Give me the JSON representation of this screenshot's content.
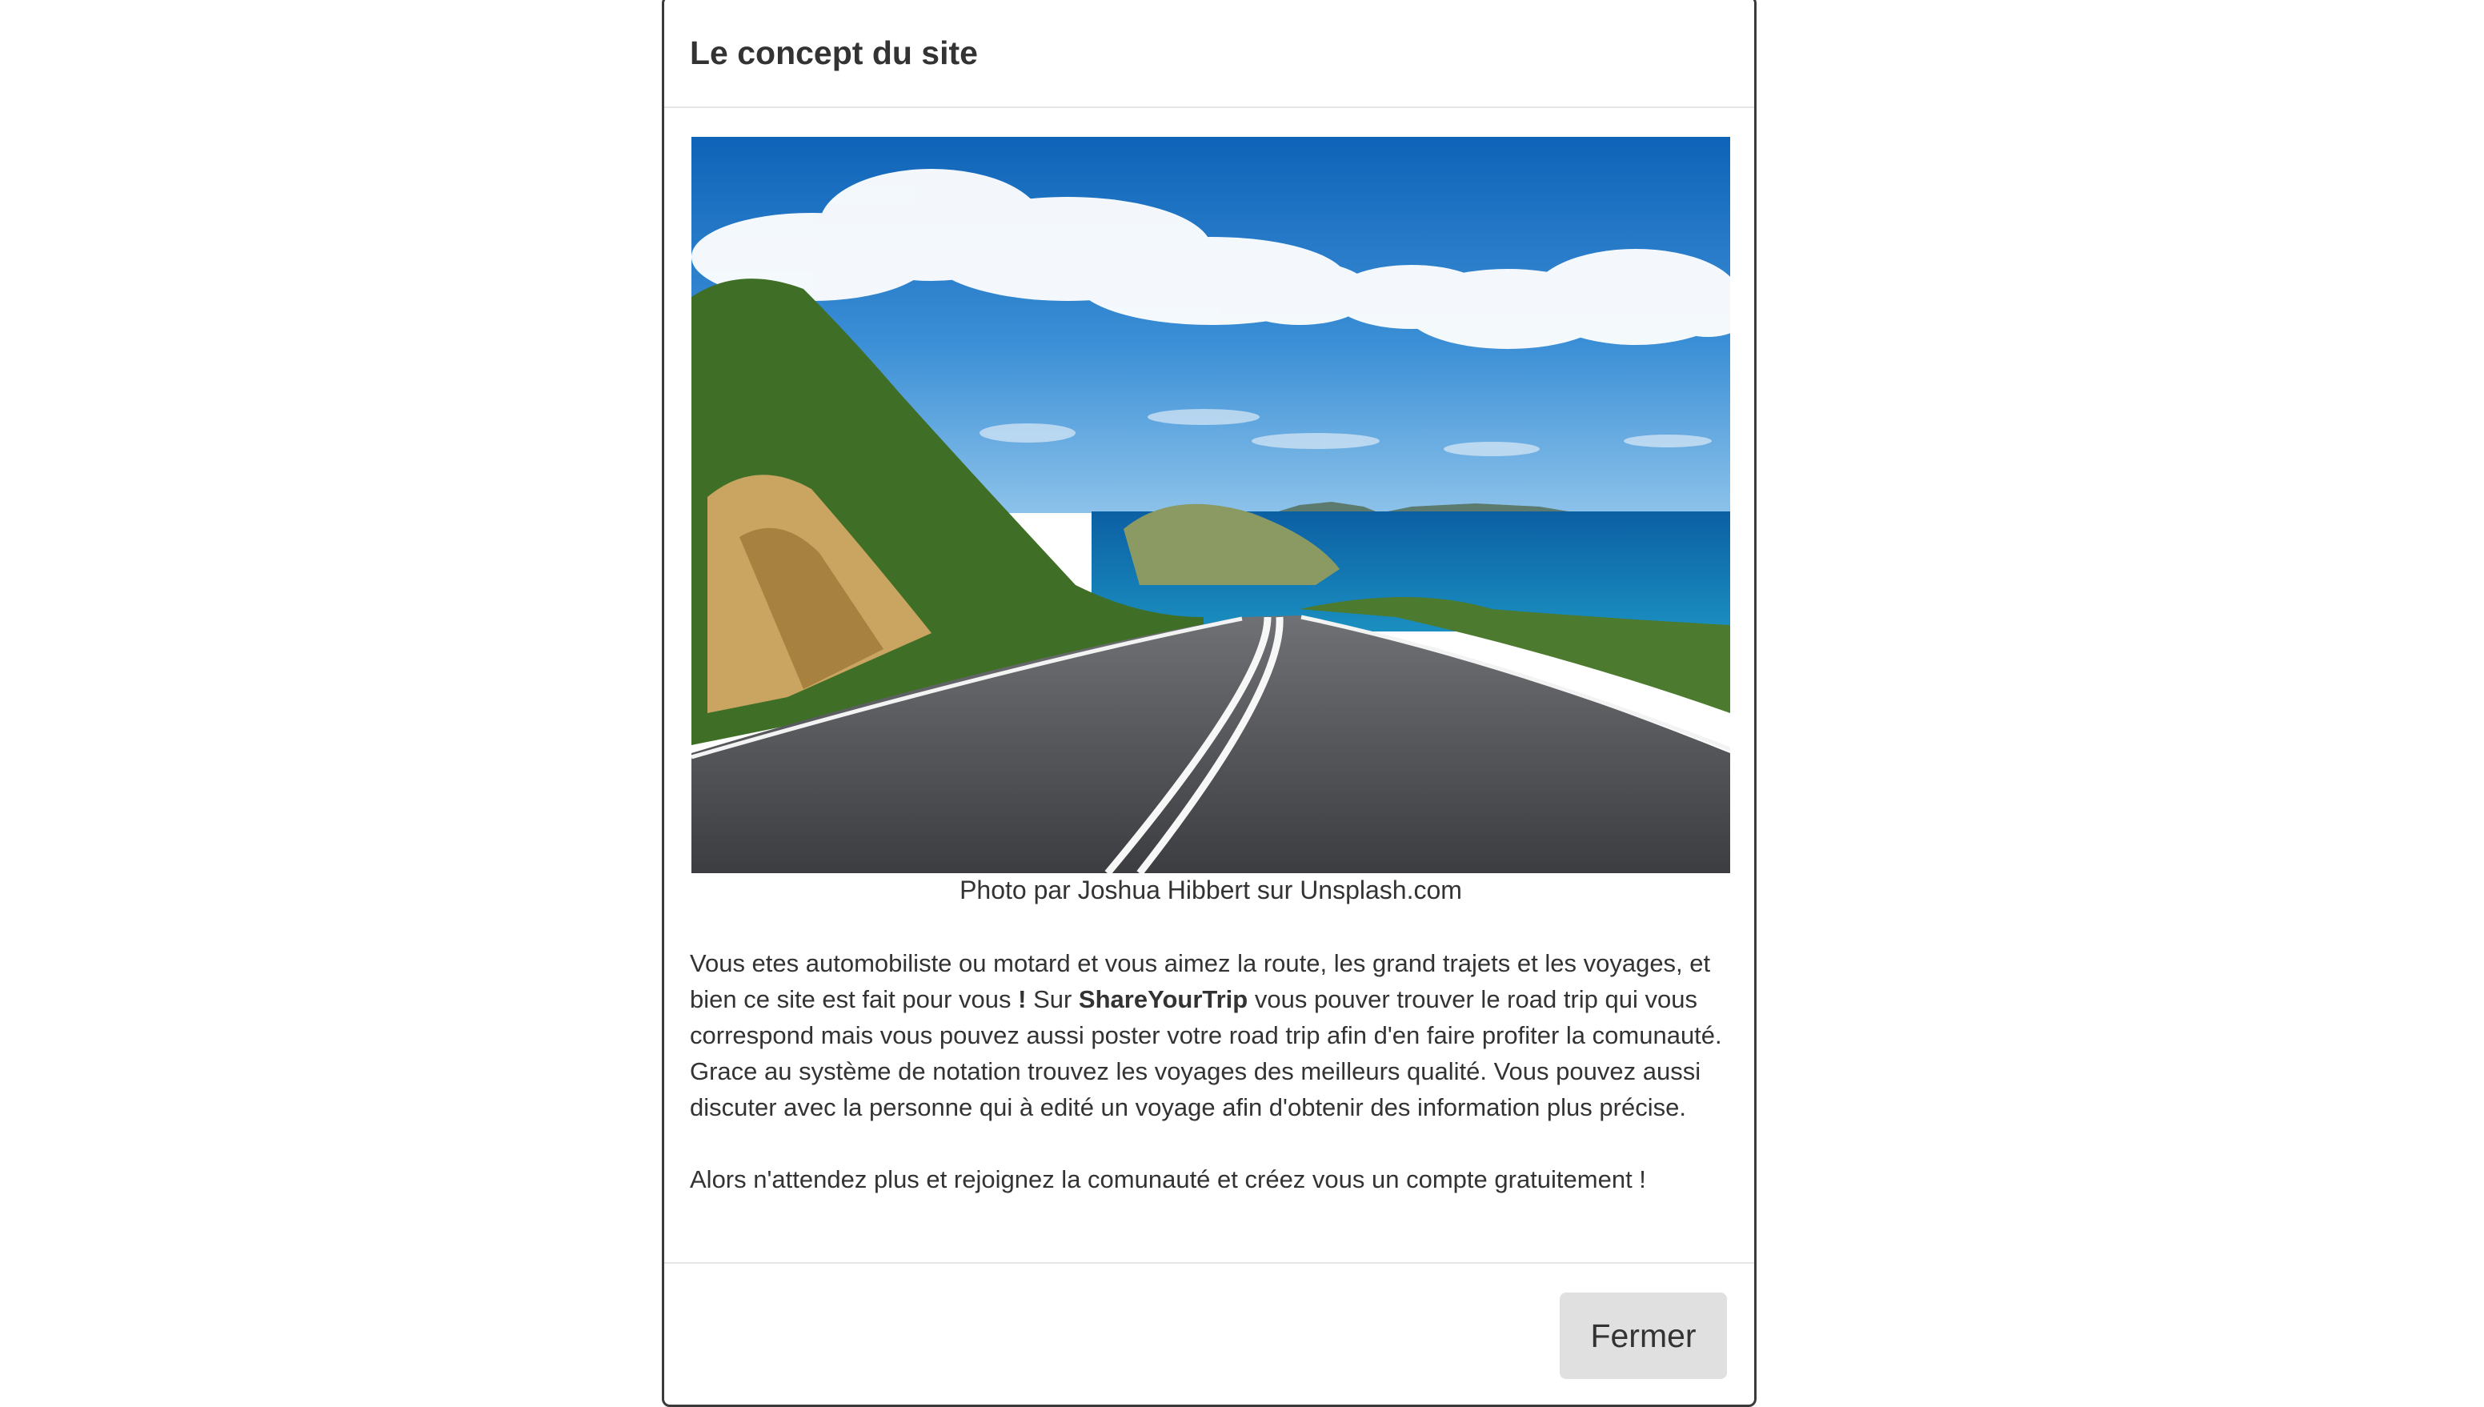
{
  "modal": {
    "title": "Le concept du site",
    "image_caption": "Photo par Joshua Hibbert sur Unsplash.com",
    "paragraph1": {
      "part1": "Vous etes automobiliste ou motard et vous aimez la route, les grand trajets et les voyages, et bien ce site est fait pour vous ",
      "exclaim": "!",
      "part2": " Sur ",
      "brand": "ShareYourTrip",
      "part3": " vous pouver trouver le road trip qui vous correspond mais vous pouvez aussi poster votre road trip afin d'en faire profiter la comunauté. Grace au système de notation trouvez les voyages des meilleurs qualité. Vous pouvez aussi discuter avec la personne qui à edité un voyage afin d'obtenir des information plus précise."
    },
    "paragraph2": "Alors n'attendez plus et rejoignez la comunauté et créez vous un compte gratuitement !",
    "close_label": "Fermer"
  },
  "colors": {
    "text": "#333333",
    "button_bg": "#e0e0e0",
    "divider": "#e5e5e5"
  }
}
